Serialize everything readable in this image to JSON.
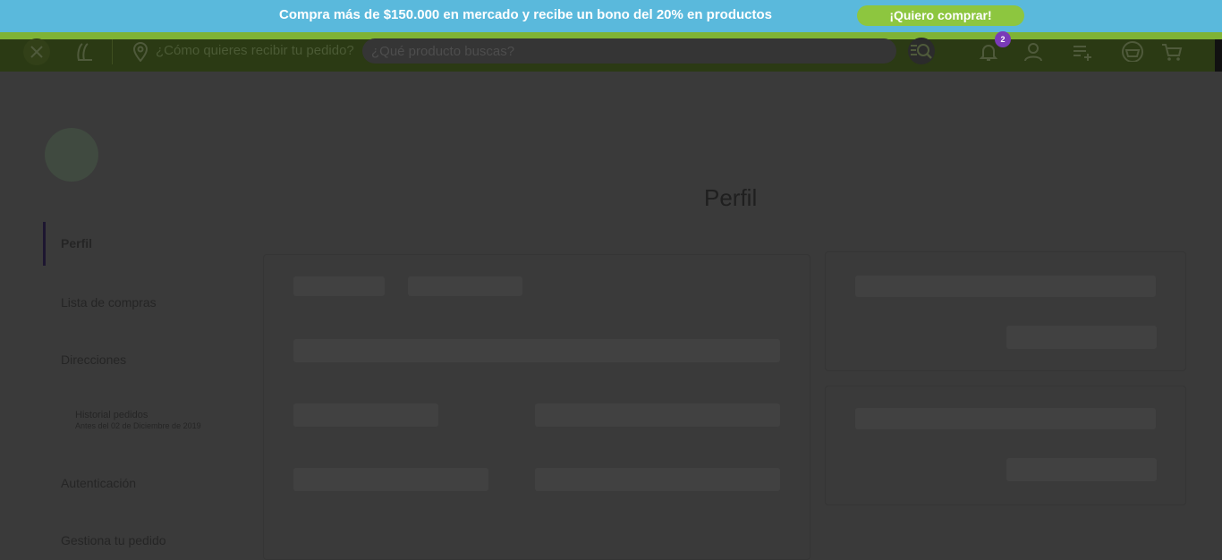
{
  "promo": {
    "text": "Compra más de $150.000 en mercado y recibe un bono del 20% en productos",
    "button_label": "¡Quiero comprar!"
  },
  "header": {
    "delivery_prompt": "¿Cómo quieres recibir tu pedido?",
    "search_placeholder": "¿Qué producto buscas?",
    "notification_count": "2"
  },
  "sidebar": {
    "items": [
      {
        "label": "Perfil"
      },
      {
        "label": "Lista de compras"
      },
      {
        "label": "Direcciones"
      },
      {
        "label": "Historial pedidos",
        "sublabel": "Antes del 02 de Diciembre de 2019"
      },
      {
        "label": "Autenticación"
      },
      {
        "label": "Gestiona tu pedido"
      }
    ]
  },
  "main": {
    "title": "Perfil"
  },
  "colors": {
    "promo_bg": "#5ab9dc",
    "accent_green": "#8dc63f",
    "badge": "#7a3ab8",
    "overlay": "#3a3a3a"
  }
}
